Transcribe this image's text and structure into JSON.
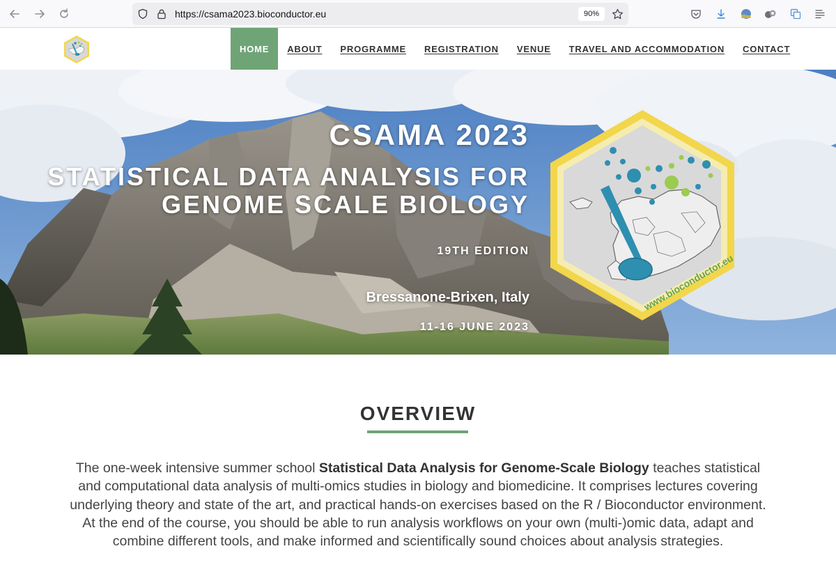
{
  "browser": {
    "url": "https://csama2023.bioconductor.eu",
    "zoom": "90%"
  },
  "site": {
    "logo_icon": "csama-hex-logo",
    "nav": [
      {
        "label": "HOME",
        "active": true
      },
      {
        "label": "ABOUT",
        "active": false
      },
      {
        "label": "PROGRAMME",
        "active": false
      },
      {
        "label": "REGISTRATION",
        "active": false
      },
      {
        "label": "VENUE",
        "active": false
      },
      {
        "label": "TRAVEL AND ACCOMMODATION",
        "active": false
      },
      {
        "label": "CONTACT",
        "active": false
      }
    ],
    "accent_color": "#6fa477"
  },
  "hero": {
    "title": "CSAMA 2023",
    "subtitle_line1": "STATISTICAL DATA ANALYSIS FOR",
    "subtitle_line2": "GENOME SCALE BIOLOGY",
    "edition": "19TH EDITION",
    "location": "Bressanone-Brixen, Italy",
    "dates": "11-16 JUNE 2023",
    "logo_text": "www.bioconductor.eu"
  },
  "overview": {
    "heading": "OVERVIEW",
    "text_before": "The one-week intensive summer school ",
    "text_bold": "Statistical Data Analysis for Genome-Scale Biology",
    "text_after": " teaches statistical and computational data analysis of multi-omics studies in biology and biomedicine. It comprises lectures covering underlying theory and state of the art, and practical hands-on exercises based on the R / Bioconductor environment. At the end of the course, you should be able to run analysis workflows on your own (multi-)omic data, adapt and combine different tools, and make informed and scientifically sound choices about analysis strategies."
  }
}
